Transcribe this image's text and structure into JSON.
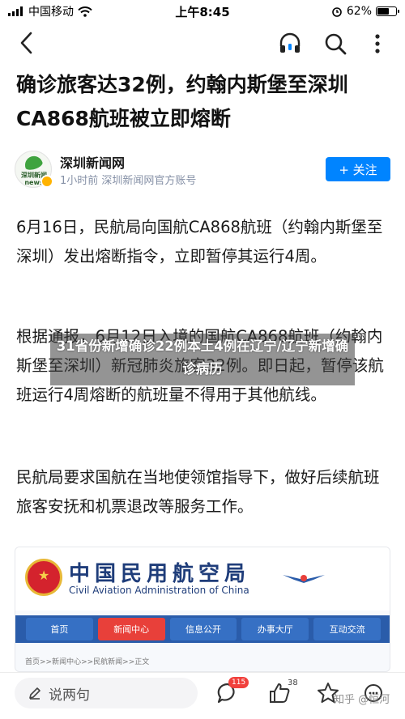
{
  "status_bar": {
    "carrier": "中国移动",
    "time": "上午8:45",
    "battery_text": "62%",
    "battery_level": 0.62
  },
  "nav": {
    "icons": [
      "back-icon",
      "headphones-icon",
      "search-icon",
      "more-icon"
    ]
  },
  "article": {
    "title": "确诊旅客达32例，约翰内斯堡至深圳CA868航班被立即熔断",
    "author": {
      "avatar_text": "深圳新闻\nnews",
      "name": "深圳新闻网",
      "meta": "1小时前 深圳新闻网官方账号",
      "follow_label": "+ 关注"
    },
    "paragraphs": [
      "6月16日，民航局向国航CA868航班（约翰内斯堡至深圳）发出熔断指令，立即暂停其运行4周。",
      "根据通报，6月12日入境的国航CA868航班（约翰内斯堡至深圳）新冠肺炎旅客32例。即日起，暂停该航班运行4周熔断的航班量不得用于其他航线。",
      "民航局要求国航在当地使领馆指导下，做好后续航班旅客安抚和机票退改等服务工作。"
    ],
    "overlay_caption": "31省份新增确诊22例本土4例在辽宁/辽宁新增确诊病历",
    "image": {
      "cn_title": "中国民用航空局",
      "en_title": "Civil Aviation Administration of China",
      "tabs": [
        "首页",
        "新闻中心",
        "信息公开",
        "办事大厅",
        "互动交流"
      ],
      "active_tab": 1,
      "breadcrumb": "首页>>新闻中心>>民航新闻>>正文"
    }
  },
  "bottom_bar": {
    "comment_placeholder": "说两句",
    "comment_count": "115",
    "like_count": "38",
    "watermark": "知乎 @恒河"
  },
  "colors": {
    "accent": "#0084ff",
    "badge": "#f1403c",
    "caac_blue": "#2a5caa",
    "caac_red": "#e8403a"
  }
}
